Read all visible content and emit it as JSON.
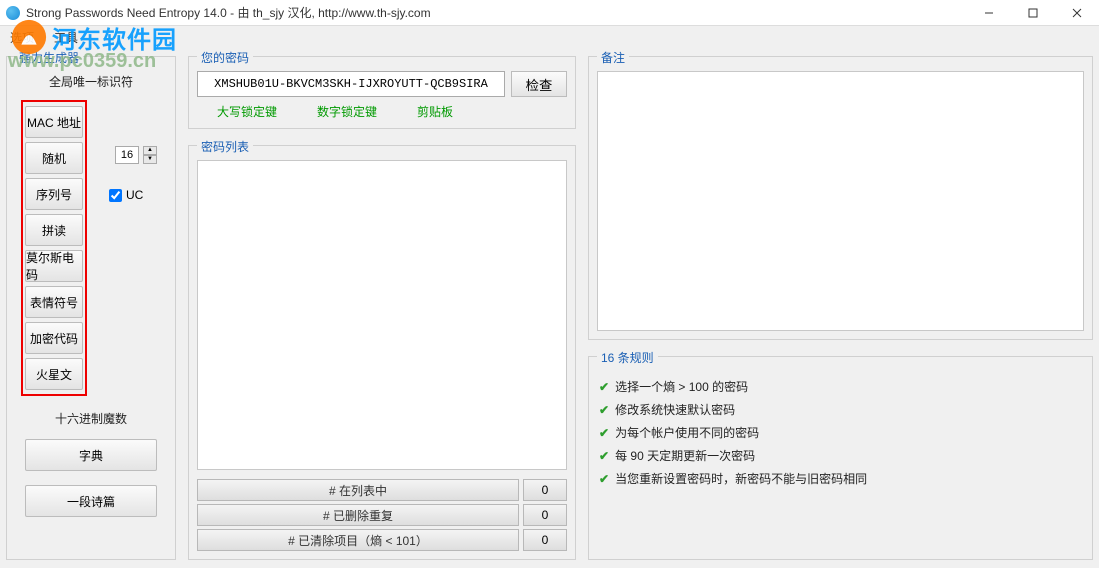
{
  "window": {
    "title": "Strong Passwords Need Entropy 14.0 - 由 th_sjy 汉化, http://www.th-sjy.com"
  },
  "menu": {
    "options": "选项",
    "tools": "工具"
  },
  "watermark": {
    "site1": "河东软件园",
    "site2": "www.pc0359.cn"
  },
  "left": {
    "group_title": "强力生成器",
    "gud_label": "全局唯一标识符",
    "buttons": {
      "mac": "MAC 地址",
      "random": "随机",
      "serial": "序列号",
      "spell": "拼读",
      "morse": "莫尔斯电码",
      "emoji": "表情符号",
      "crypto": "加密代码",
      "martian": "火星文"
    },
    "spin_value": "16",
    "uc_check": true,
    "uc_label": "UC",
    "hex_label": "十六进制魔数",
    "dict_btn": "字典",
    "poem_btn": "一段诗篇"
  },
  "mid": {
    "pw_title": "您的密码",
    "pw_value": "XMSHUB01U-BKVCM3SKH-IJXROYUTT-QCB9SIRA",
    "check_btn": "检查",
    "locks": {
      "caps": "大写锁定键",
      "num": "数字锁定键",
      "clip": "剪贴板"
    },
    "list_title": "密码列表",
    "stats": {
      "in_list": {
        "label": "# 在列表中",
        "count": "0"
      },
      "dedup": {
        "label": "# 已删除重复",
        "count": "0"
      },
      "cleared": {
        "label": "# 已清除项目（熵 < 101）",
        "count": "0"
      }
    }
  },
  "right": {
    "notes_title": "备注",
    "rules_title": "16 条规则",
    "rules": [
      "选择一个熵 > 100 的密码",
      "修改系统快速默认密码",
      "为每个帐户使用不同的密码",
      "每 90 天定期更新一次密码",
      "当您重新设置密码时，新密码不能与旧密码相同"
    ]
  }
}
